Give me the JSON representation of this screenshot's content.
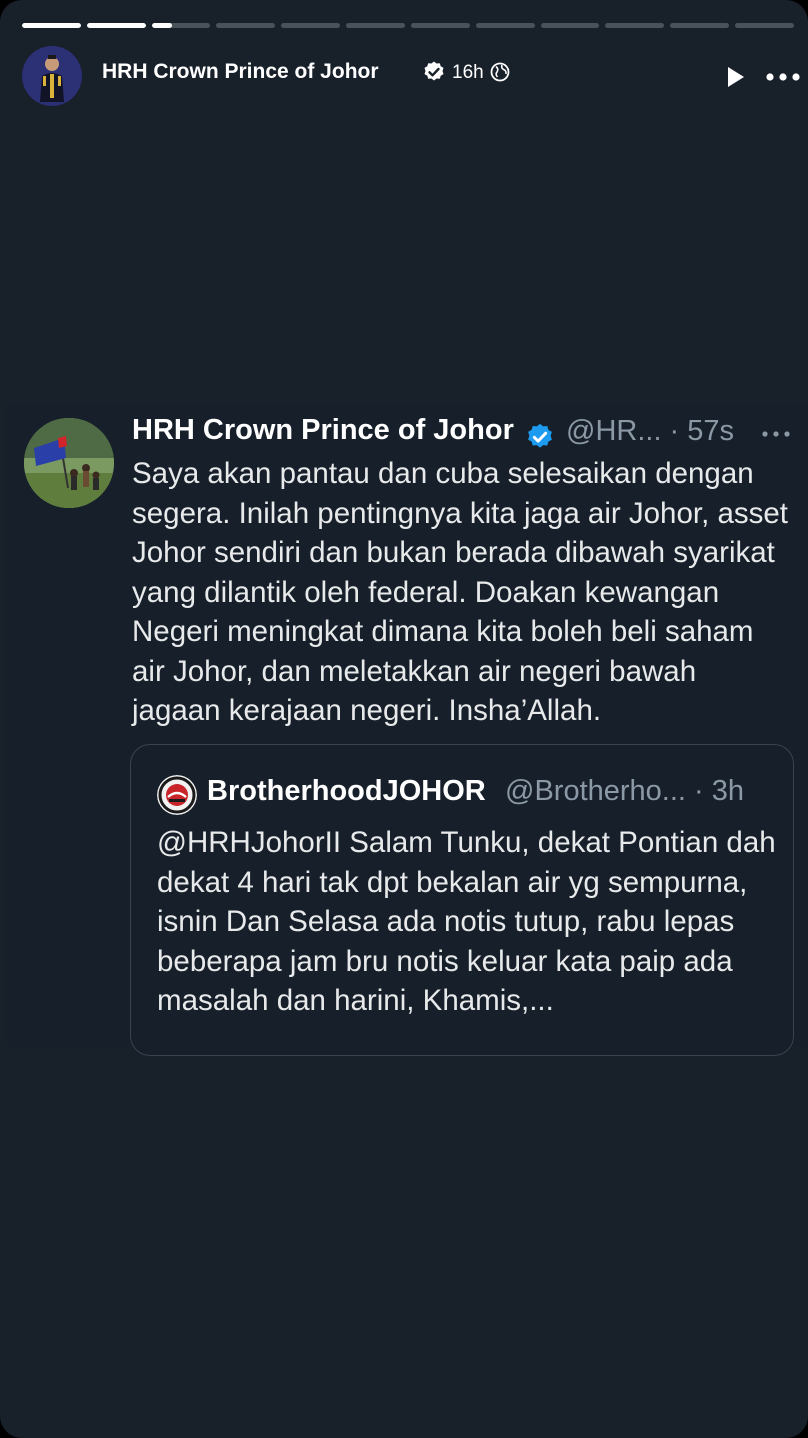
{
  "story": {
    "progress": [
      1,
      1,
      0.35,
      0,
      0,
      0,
      0,
      0,
      0,
      0,
      0,
      0
    ],
    "author": "HRH Crown Prince of Johor",
    "time": "16h",
    "icons": {
      "verified": "verified-badge-icon",
      "audience": "globe-icon",
      "play": "play-icon",
      "more": "more-horizontal-icon"
    }
  },
  "tweet": {
    "name": "HRH Crown Prince of Johor",
    "handle_time": "@HR... · 57s",
    "text": "Saya akan pantau dan cuba selesaikan dengan segera. Inilah pentingnya kita jaga air Johor, asset Johor sendiri dan bukan berada dibawah syarikat yang dilantik oleh federal. Doakan kewangan Negeri meningkat dimana kita boleh beli saham air Johor, dan meletakkan air negeri bawah jagaan kerajaan negeri. Insha’Allah.",
    "verified_color": "#1d9bf0",
    "quote": {
      "name": "BrotherhoodJOHOR",
      "handle_time": "@Brotherho... · 3h",
      "text": "@HRHJohorII Salam Tunku, dekat Pontian dah dekat 4 hari tak dpt bekalan air yg sempurna, isnin Dan Selasa ada notis tutup, rabu lepas beberapa jam bru notis keluar kata paip ada masalah dan harini, Khamis,..."
    }
  }
}
